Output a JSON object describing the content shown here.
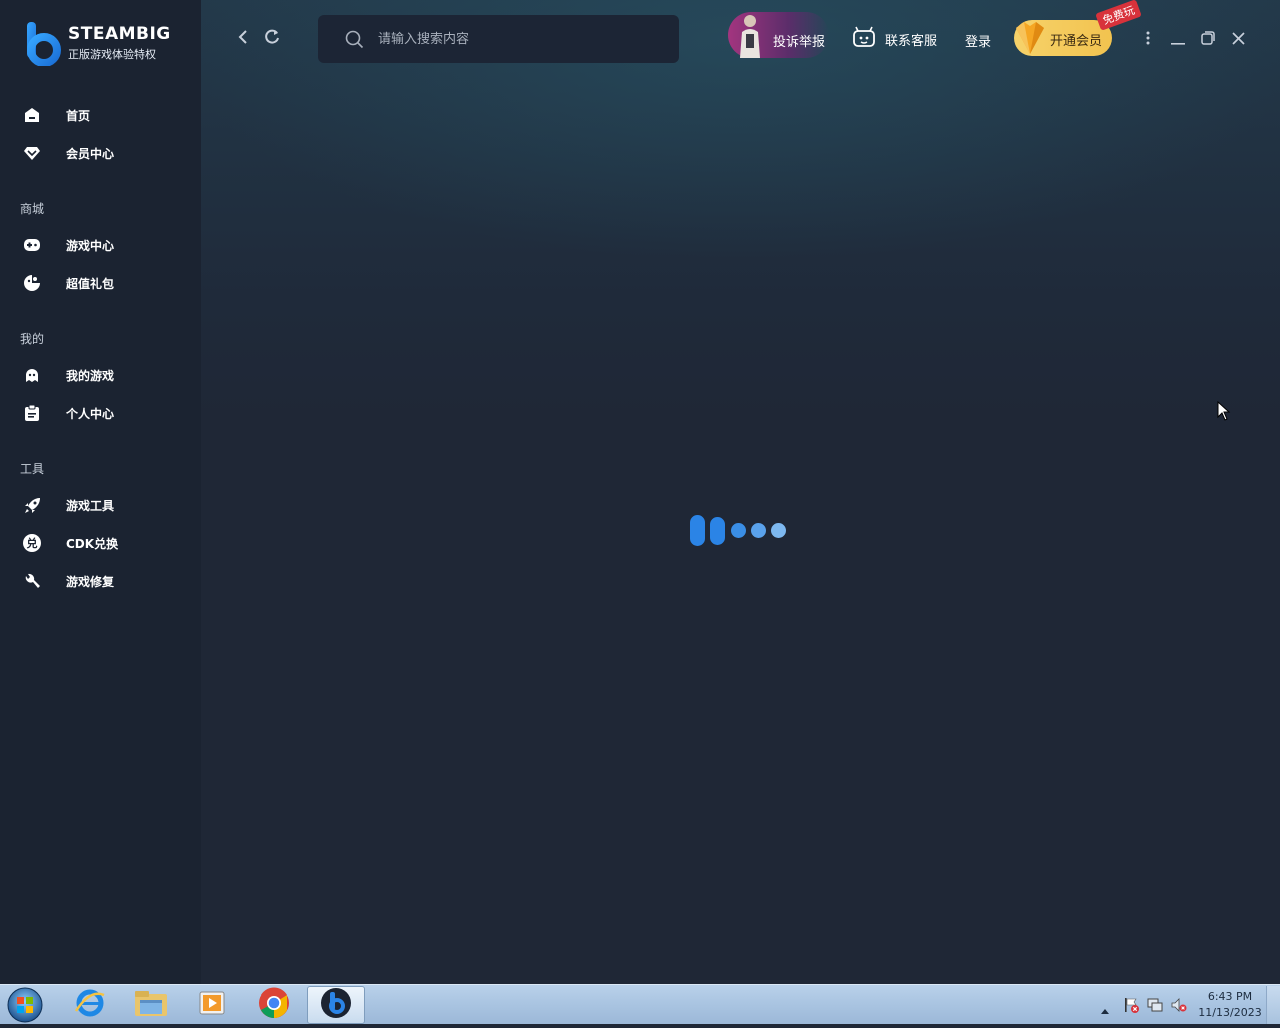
{
  "brand": {
    "name": "STEAMBIG",
    "tagline": "正版游戏体验特权",
    "color": "#2b84e6"
  },
  "sidebar": {
    "items_top": [
      {
        "label": "首页",
        "icon": "home-icon"
      },
      {
        "label": "会员中心",
        "icon": "diamond-icon"
      }
    ],
    "sections": [
      {
        "label": "商城",
        "items": [
          {
            "label": "游戏中心",
            "icon": "gamepad-icon"
          },
          {
            "label": "超值礼包",
            "icon": "gift-icon"
          }
        ]
      },
      {
        "label": "我的",
        "items": [
          {
            "label": "我的游戏",
            "icon": "ghost-icon"
          },
          {
            "label": "个人中心",
            "icon": "clipboard-icon"
          }
        ]
      },
      {
        "label": "工具",
        "items": [
          {
            "label": "游戏工具",
            "icon": "rocket-icon"
          },
          {
            "label": "CDK兑换",
            "icon": "redeem-icon"
          },
          {
            "label": "游戏修复",
            "icon": "wrench-icon"
          }
        ]
      }
    ]
  },
  "topbar": {
    "search_placeholder": "请输入搜索内容",
    "report_label": "投诉举报",
    "support_label": "联系客服",
    "login_label": "登录",
    "vip_label": "开通会员",
    "vip_tag": "免费玩"
  },
  "loader": {
    "colors": [
      "#2b84e6",
      "#2b84e6",
      "#3a8ee6",
      "#5aa2ec",
      "#7db8f0"
    ]
  },
  "taskbar": {
    "apps": [
      "ie-icon",
      "explorer-icon",
      "media-player-icon",
      "chrome-icon",
      "steambig-icon"
    ],
    "clock_time": "6:43 PM",
    "clock_date": "11/13/2023"
  }
}
